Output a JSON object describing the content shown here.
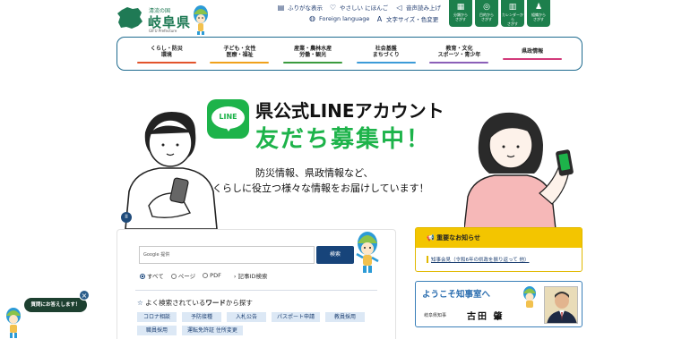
{
  "header": {
    "logo_sub": "清流の国",
    "logo_title": "岐阜県",
    "logo_en": "GIFU Prefecture",
    "utilities": [
      {
        "icon": "furigana-icon",
        "label": "ふりがな表示"
      },
      {
        "icon": "heart-icon",
        "label": "やさしい にほんご"
      },
      {
        "icon": "speaker-icon",
        "label": "音声読み上げ"
      }
    ],
    "utilities2": [
      {
        "icon": "globe-icon",
        "label": "Foreign language"
      },
      {
        "icon": "text-size-icon",
        "label": "文字サイズ・色変更"
      }
    ],
    "tiles": [
      {
        "icon": "category-icon",
        "label1": "分類から",
        "label2": "さがす"
      },
      {
        "icon": "purpose-icon",
        "label1": "目的から",
        "label2": "さがす"
      },
      {
        "icon": "calendar-icon",
        "label1": "カレンダーから",
        "label2": "さがす"
      },
      {
        "icon": "organization-icon",
        "label1": "組織から",
        "label2": "さがす"
      }
    ]
  },
  "nav": {
    "items": [
      {
        "line1": "くらし・防災",
        "line2": "環境",
        "color": "#e2542c"
      },
      {
        "line1": "子ども・女性",
        "line2": "医療・福祉",
        "color": "#f0a11b"
      },
      {
        "line1": "産業・農林水産",
        "line2": "労働・観光",
        "color": "#3a9b3e"
      },
      {
        "line1": "社会基盤",
        "line2": "まちづくり",
        "color": "#3b9bd8"
      },
      {
        "line1": "教育・文化",
        "line2": "スポーツ・青少年",
        "color": "#8b5fb8"
      },
      {
        "line1": "県政情報",
        "line2": "",
        "color": "#d23a7a"
      }
    ]
  },
  "hero": {
    "logo_text": "LINE",
    "title1": "県公式LINEアカウント",
    "title2": "友だち募集中！",
    "sub1": "防災情報、県政情報など、",
    "sub2": "くらしに役立つ様々な情報をお届けしています！",
    "prev_label": "‹",
    "next_label": "›",
    "pause_label": "II"
  },
  "search": {
    "placeholder": "Google 提供",
    "button": "検索",
    "radio_all": "すべて",
    "radio_page": "ページ",
    "radio_pdf": "PDF",
    "kiji": "記事ID検索",
    "freq_pre": "よく検索されている",
    "freq_bold": "ワード",
    "freq_post": "から探す",
    "tags": [
      "コロナ相談",
      "予防接種",
      "入札公告",
      "パスポート申請",
      "教員採用",
      "職員採用",
      "運転免許証 住所変更"
    ]
  },
  "notice": {
    "title": "重要なお知らせ",
    "item": "知事会見（令和6年の県政を振り返って 他）"
  },
  "governor": {
    "title": "ようこそ知事室へ",
    "subtitle": "岐阜県知事",
    "name": "古田 肇"
  },
  "chat": {
    "label": "質問にお答えします！",
    "close": "×"
  }
}
